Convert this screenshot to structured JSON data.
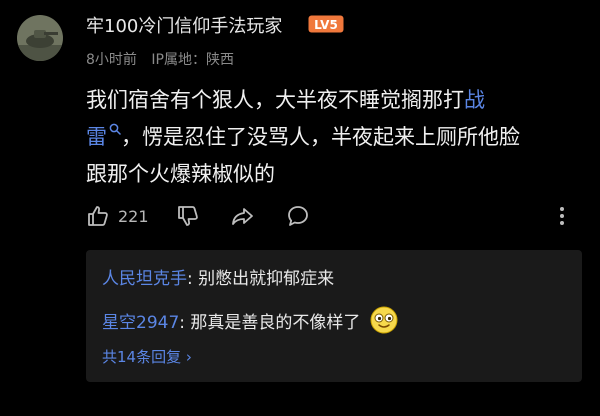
{
  "comment": {
    "username": "牢100冷门信仰手法玩家",
    "level_badge": "LV5",
    "time": "8小时前",
    "ip_location": "IP属地：陕西",
    "content_line1": "我们宿舍有个狠人，大半夜不睡觉搁那打",
    "content_link_a": "战",
    "content_link_b": "雷",
    "content_line2_rest": "，愣是忍住了没骂人，半夜起来上厕所他脸",
    "content_line3": "跟那个火爆辣椒似的",
    "like_count": "221"
  },
  "replies": [
    {
      "author": "人民坦克手",
      "sep": ": ",
      "text": "别憋出就抑郁症来"
    },
    {
      "author": "星空2947",
      "sep": ": ",
      "text": "那真是善良的不像样了"
    }
  ],
  "more_replies": "共14条回复 ›",
  "colors": {
    "link": "#5b86e5",
    "badge": "#f0783c"
  }
}
